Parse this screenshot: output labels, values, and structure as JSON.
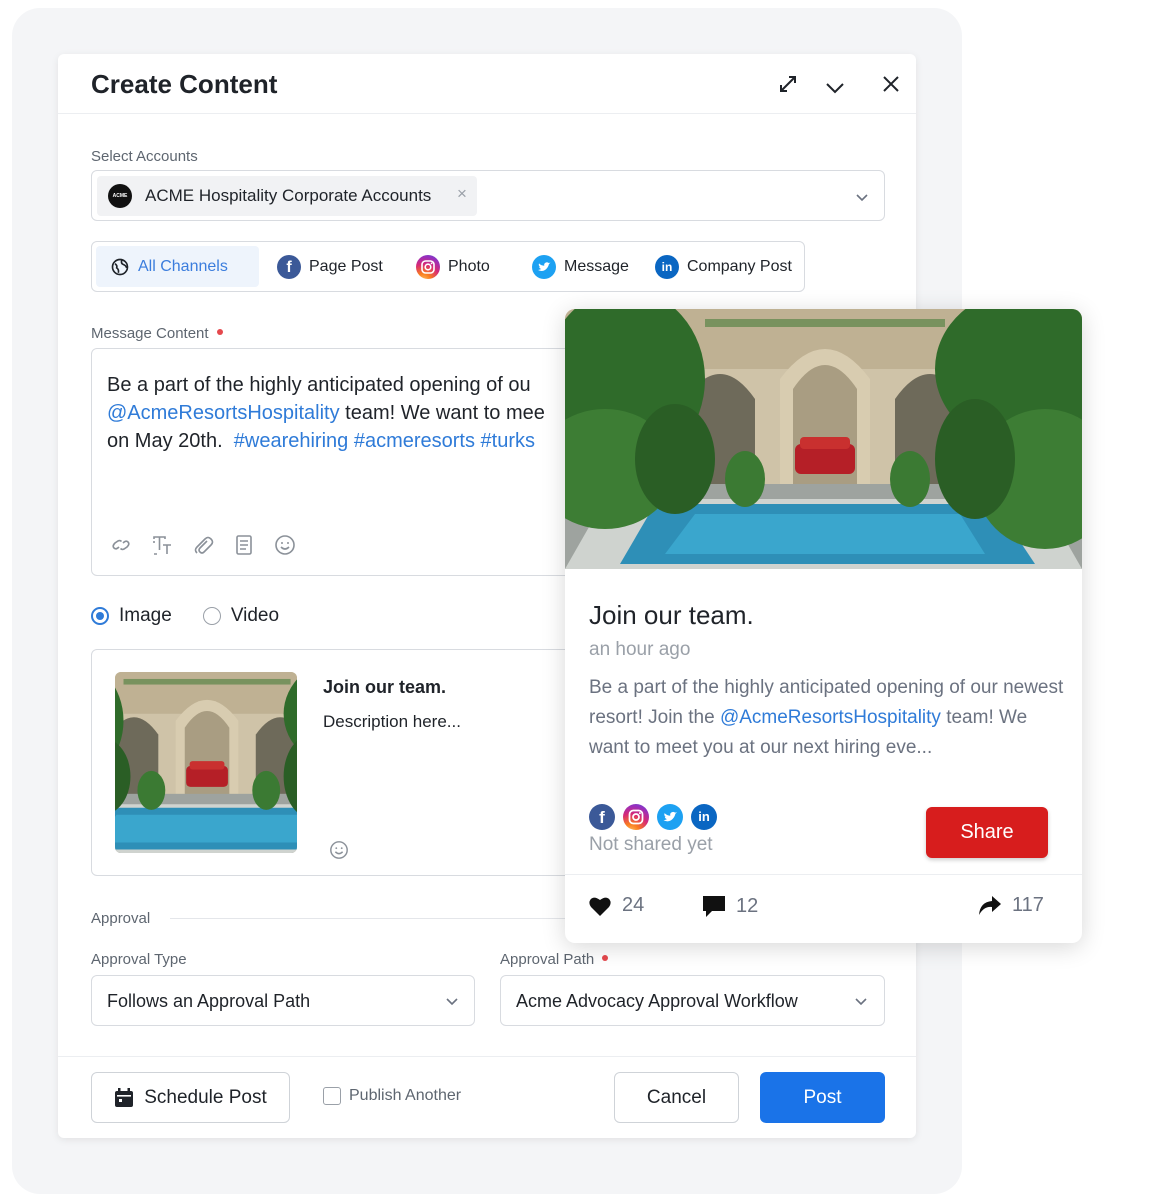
{
  "dialog": {
    "title": "Create Content"
  },
  "accounts": {
    "label": "Select Accounts",
    "selected": "ACME Hospitality Corporate Accounts",
    "logo_text": "ACME",
    "remove_glyph": "×"
  },
  "channels": [
    {
      "label": "All Channels",
      "icon": "globe-icon",
      "active": true
    },
    {
      "label": "Page Post",
      "icon": "facebook-icon"
    },
    {
      "label": "Photo",
      "icon": "instagram-icon"
    },
    {
      "label": "Message",
      "icon": "twitter-icon"
    },
    {
      "label": "Company Post",
      "icon": "linkedin-icon"
    }
  ],
  "message": {
    "label": "Message Content",
    "line1": "Be a part of the highly anticipated opening of ou",
    "mention": "@AcmeResortsHospitality",
    "line2_rest": " team! We want to mee",
    "line3_start": "on May 20th.",
    "hashtags": "#wearehiring #acmeresorts #turks",
    "tools": [
      "link-icon",
      "text-format-icon",
      "attachment-icon",
      "document-icon",
      "emoji-icon"
    ]
  },
  "media_type": {
    "image_label": "Image",
    "video_label": "Video",
    "selected": "Image"
  },
  "media": {
    "title": "Join our team.",
    "description": "Description here..."
  },
  "approval": {
    "section_label": "Approval",
    "type_label": "Approval Type",
    "type_value": "Follows an Approval Path",
    "path_label": "Approval Path",
    "path_value": "Acme Advocacy Approval Workflow"
  },
  "footer": {
    "schedule_label": "Schedule Post",
    "publish_another_label": "Publish Another",
    "cancel_label": "Cancel",
    "post_label": "Post"
  },
  "preview": {
    "title": "Join our team.",
    "time": "an hour ago",
    "body_start": "Be a part of the highly anticipated opening of our newest resort! Join the ",
    "body_mention": "@AcmeResortsHospitality",
    "body_end": " team! We want to meet you at our next hiring eve...",
    "networks": [
      "facebook-icon",
      "instagram-icon",
      "twitter-icon",
      "linkedin-icon"
    ],
    "status": "Not shared yet",
    "share_label": "Share",
    "likes": "24",
    "comments": "12",
    "shares": "117"
  },
  "colors": {
    "primary": "#1a73e8",
    "share": "#d71d1d",
    "link": "#2f7bd8",
    "facebook": "#3b5998",
    "twitter": "#1da1f2",
    "linkedin": "#0a66c2"
  }
}
